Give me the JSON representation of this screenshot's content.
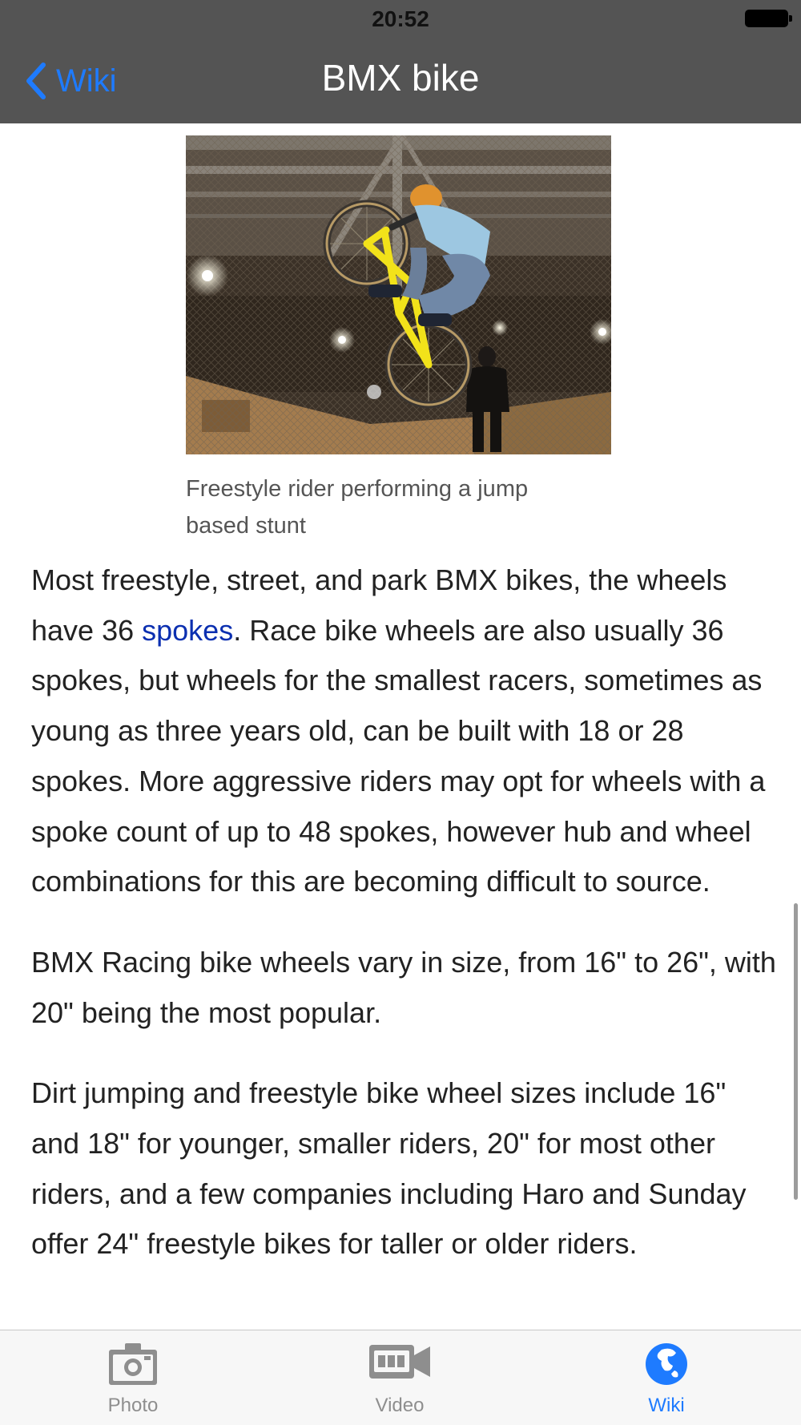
{
  "status_bar": {
    "time": "20:52"
  },
  "nav_bar": {
    "back_label": "Wiki",
    "title": "BMX bike"
  },
  "figure": {
    "caption": "Freestyle rider performing a jump based stunt"
  },
  "article": {
    "p1_before_link": "Most freestyle, street, and park BMX bikes, the wheels have 36 ",
    "p1_link": "spokes",
    "p1_after_link": ". Race bike wheels are also usually 36 spokes, but wheels for the smallest racers, sometimes as young as three years old, can be built with 18 or 28 spokes. More aggressive riders may opt for wheels with a spoke count of up to 48 spokes, however hub and wheel combinations for this are becoming difficult to source.",
    "p2": "BMX Racing bike wheels vary in size, from 16\" to 26\", with 20\" being the most popular.",
    "p3": "Dirt jumping and freestyle bike wheel sizes include 16\" and 18\" for younger, smaller riders, 20\" for most other riders, and a few companies including Haro and Sunday offer 24\" freestyle bikes for taller or older riders."
  },
  "tab_bar": {
    "tabs": [
      {
        "label": "Photo",
        "icon": "camera-icon",
        "active": false
      },
      {
        "label": "Video",
        "icon": "video-camera-icon",
        "active": false
      },
      {
        "label": "Wiki",
        "icon": "globe-icon",
        "active": true
      }
    ]
  },
  "colors": {
    "nav_background": "#545454",
    "accent": "#1e7bff",
    "link": "#0b2fb0",
    "tab_inactive": "#8e8e8e"
  }
}
